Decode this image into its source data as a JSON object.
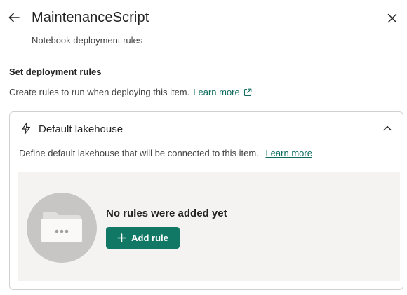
{
  "header": {
    "title": "MaintenanceScript",
    "subtitle": "Notebook deployment rules"
  },
  "section": {
    "heading": "Set deployment rules",
    "description": "Create rules to run when deploying this item.",
    "learn_more": "Learn more"
  },
  "rule_card": {
    "title": "Default lakehouse",
    "expanded": true,
    "description": "Define default lakehouse that will be connected to this item.",
    "learn_more": "Learn more",
    "empty_state": {
      "message": "No rules were added yet",
      "add_button_label": "Add rule"
    }
  },
  "icons": {
    "back": "arrow-left-icon",
    "close": "close-icon",
    "external": "open-external-icon",
    "rule_type": "lightning-bolt-icon",
    "collapse": "chevron-up-icon",
    "empty": "folder-icon",
    "add": "plus-icon"
  },
  "colors": {
    "accent": "#117865",
    "link": "#0f6c5f",
    "empty_background": "#f5f3f2",
    "illustration_circle": "#c8c6c4"
  }
}
